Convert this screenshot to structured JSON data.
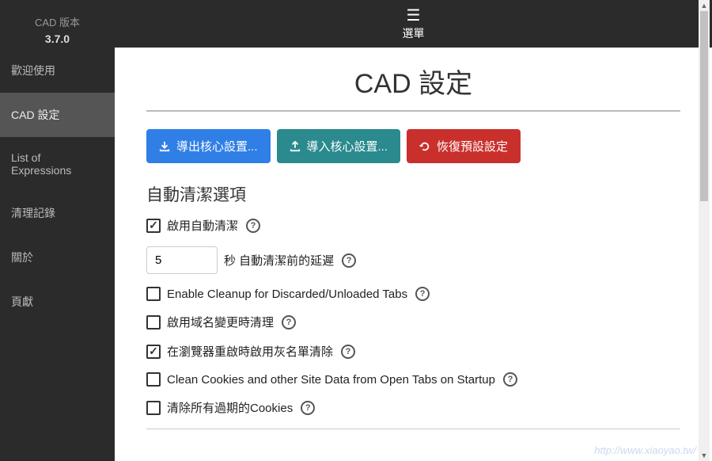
{
  "sidebar": {
    "version_label": "CAD 版本",
    "version": "3.7.0",
    "items": [
      {
        "label": "歡迎使用",
        "active": false
      },
      {
        "label": "CAD 設定",
        "active": true
      },
      {
        "label": "List of Expressions",
        "active": false
      },
      {
        "label": "清理記錄",
        "active": false
      },
      {
        "label": "關於",
        "active": false
      },
      {
        "label": "頁獻",
        "active": false
      }
    ]
  },
  "topbar": {
    "menu_label": "選單"
  },
  "page": {
    "title": "CAD 設定"
  },
  "buttons": {
    "export": "導出核心設置...",
    "import": "導入核心設置...",
    "reset": "恢復預設設定"
  },
  "auto_clean": {
    "section_title": "自動清潔選項",
    "options": [
      {
        "label": "啟用自動清潔",
        "checked": true
      },
      {
        "label": "Enable Cleanup for Discarded/Unloaded Tabs",
        "checked": false
      },
      {
        "label": "啟用域名變更時清理",
        "checked": false
      },
      {
        "label": "在瀏覽器重啟時啟用灰名單清除",
        "checked": true
      },
      {
        "label": "Clean Cookies and other Site Data from Open Tabs on Startup",
        "checked": false
      },
      {
        "label": "清除所有過期的Cookies",
        "checked": false
      }
    ],
    "delay_value": "5",
    "delay_label": "秒 自動清潔前的延遲"
  },
  "watermark": "http://www.xiaoyao.tw/"
}
